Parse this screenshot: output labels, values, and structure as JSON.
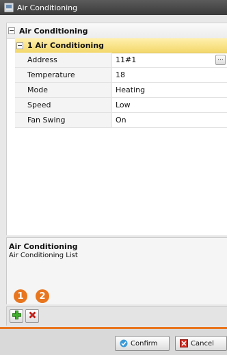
{
  "window": {
    "title": "Air Conditioning"
  },
  "tree": {
    "root_label": "Air Conditioning",
    "section_label": "1 Air Conditioning",
    "properties": [
      {
        "name": "Address",
        "value": "11#1"
      },
      {
        "name": "Temperature",
        "value": "18"
      },
      {
        "name": "Mode",
        "value": "Heating"
      },
      {
        "name": "Speed",
        "value": "Low"
      },
      {
        "name": "Fan Swing",
        "value": "On"
      }
    ],
    "ellipsis_label": "..."
  },
  "description": {
    "title": "Air Conditioning",
    "text": "Air Conditioning List"
  },
  "callouts": [
    "1",
    "2"
  ],
  "toolbar": {
    "add_icon": "plus-icon",
    "delete_icon": "delete-x-icon"
  },
  "footer": {
    "confirm_label": "Confirm",
    "cancel_label": "Cancel"
  },
  "colors": {
    "accent": "#e8761f",
    "section_highlight": "#f6dd7a",
    "titlebar": "#4a4a4a"
  }
}
